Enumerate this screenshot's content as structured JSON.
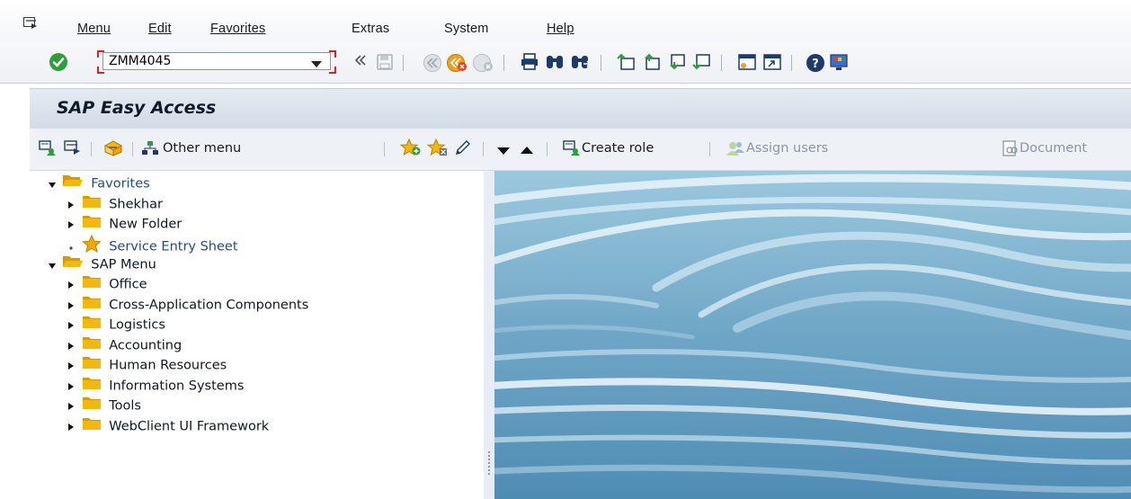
{
  "menubar": {
    "items": [
      {
        "label": "Menu"
      },
      {
        "label": "Edit"
      },
      {
        "label": "Favorites"
      },
      {
        "label": "Extras"
      },
      {
        "label": "System"
      },
      {
        "label": "Help"
      }
    ]
  },
  "systoolbar": {
    "command_value": "ZMM4045",
    "icons": [
      "enter-check-icon",
      "expand-history-icon",
      "save-icon",
      "back-icon",
      "exit-icon",
      "cancel-icon",
      "print-icon",
      "find-icon",
      "find-next-icon",
      "first-page-icon",
      "previous-page-icon",
      "next-page-icon",
      "last-page-icon",
      "new-session-icon",
      "create-shortcut-icon",
      "help-icon",
      "customize-layout-icon"
    ]
  },
  "title": "SAP Easy Access",
  "apptoolbar": {
    "other_menu": "Other menu",
    "create_role": "Create role",
    "assign_users": "Assign users",
    "documentation": "Document"
  },
  "tree": {
    "favorites": {
      "label": "Favorites",
      "children": [
        "Shekhar",
        "New Folder",
        "Service Entry Sheet"
      ]
    },
    "sap_menu": {
      "label": "SAP Menu",
      "children": [
        "Office",
        "Cross-Application Components",
        "Logistics",
        "Accounting",
        "Human Resources",
        "Information Systems",
        "Tools",
        "WebClient UI Framework"
      ]
    }
  },
  "colors": {
    "folder": "#f2b90c",
    "folder_dark": "#d89a00",
    "ok_green": "#2f9e3a",
    "selection_border": "#e02020"
  }
}
